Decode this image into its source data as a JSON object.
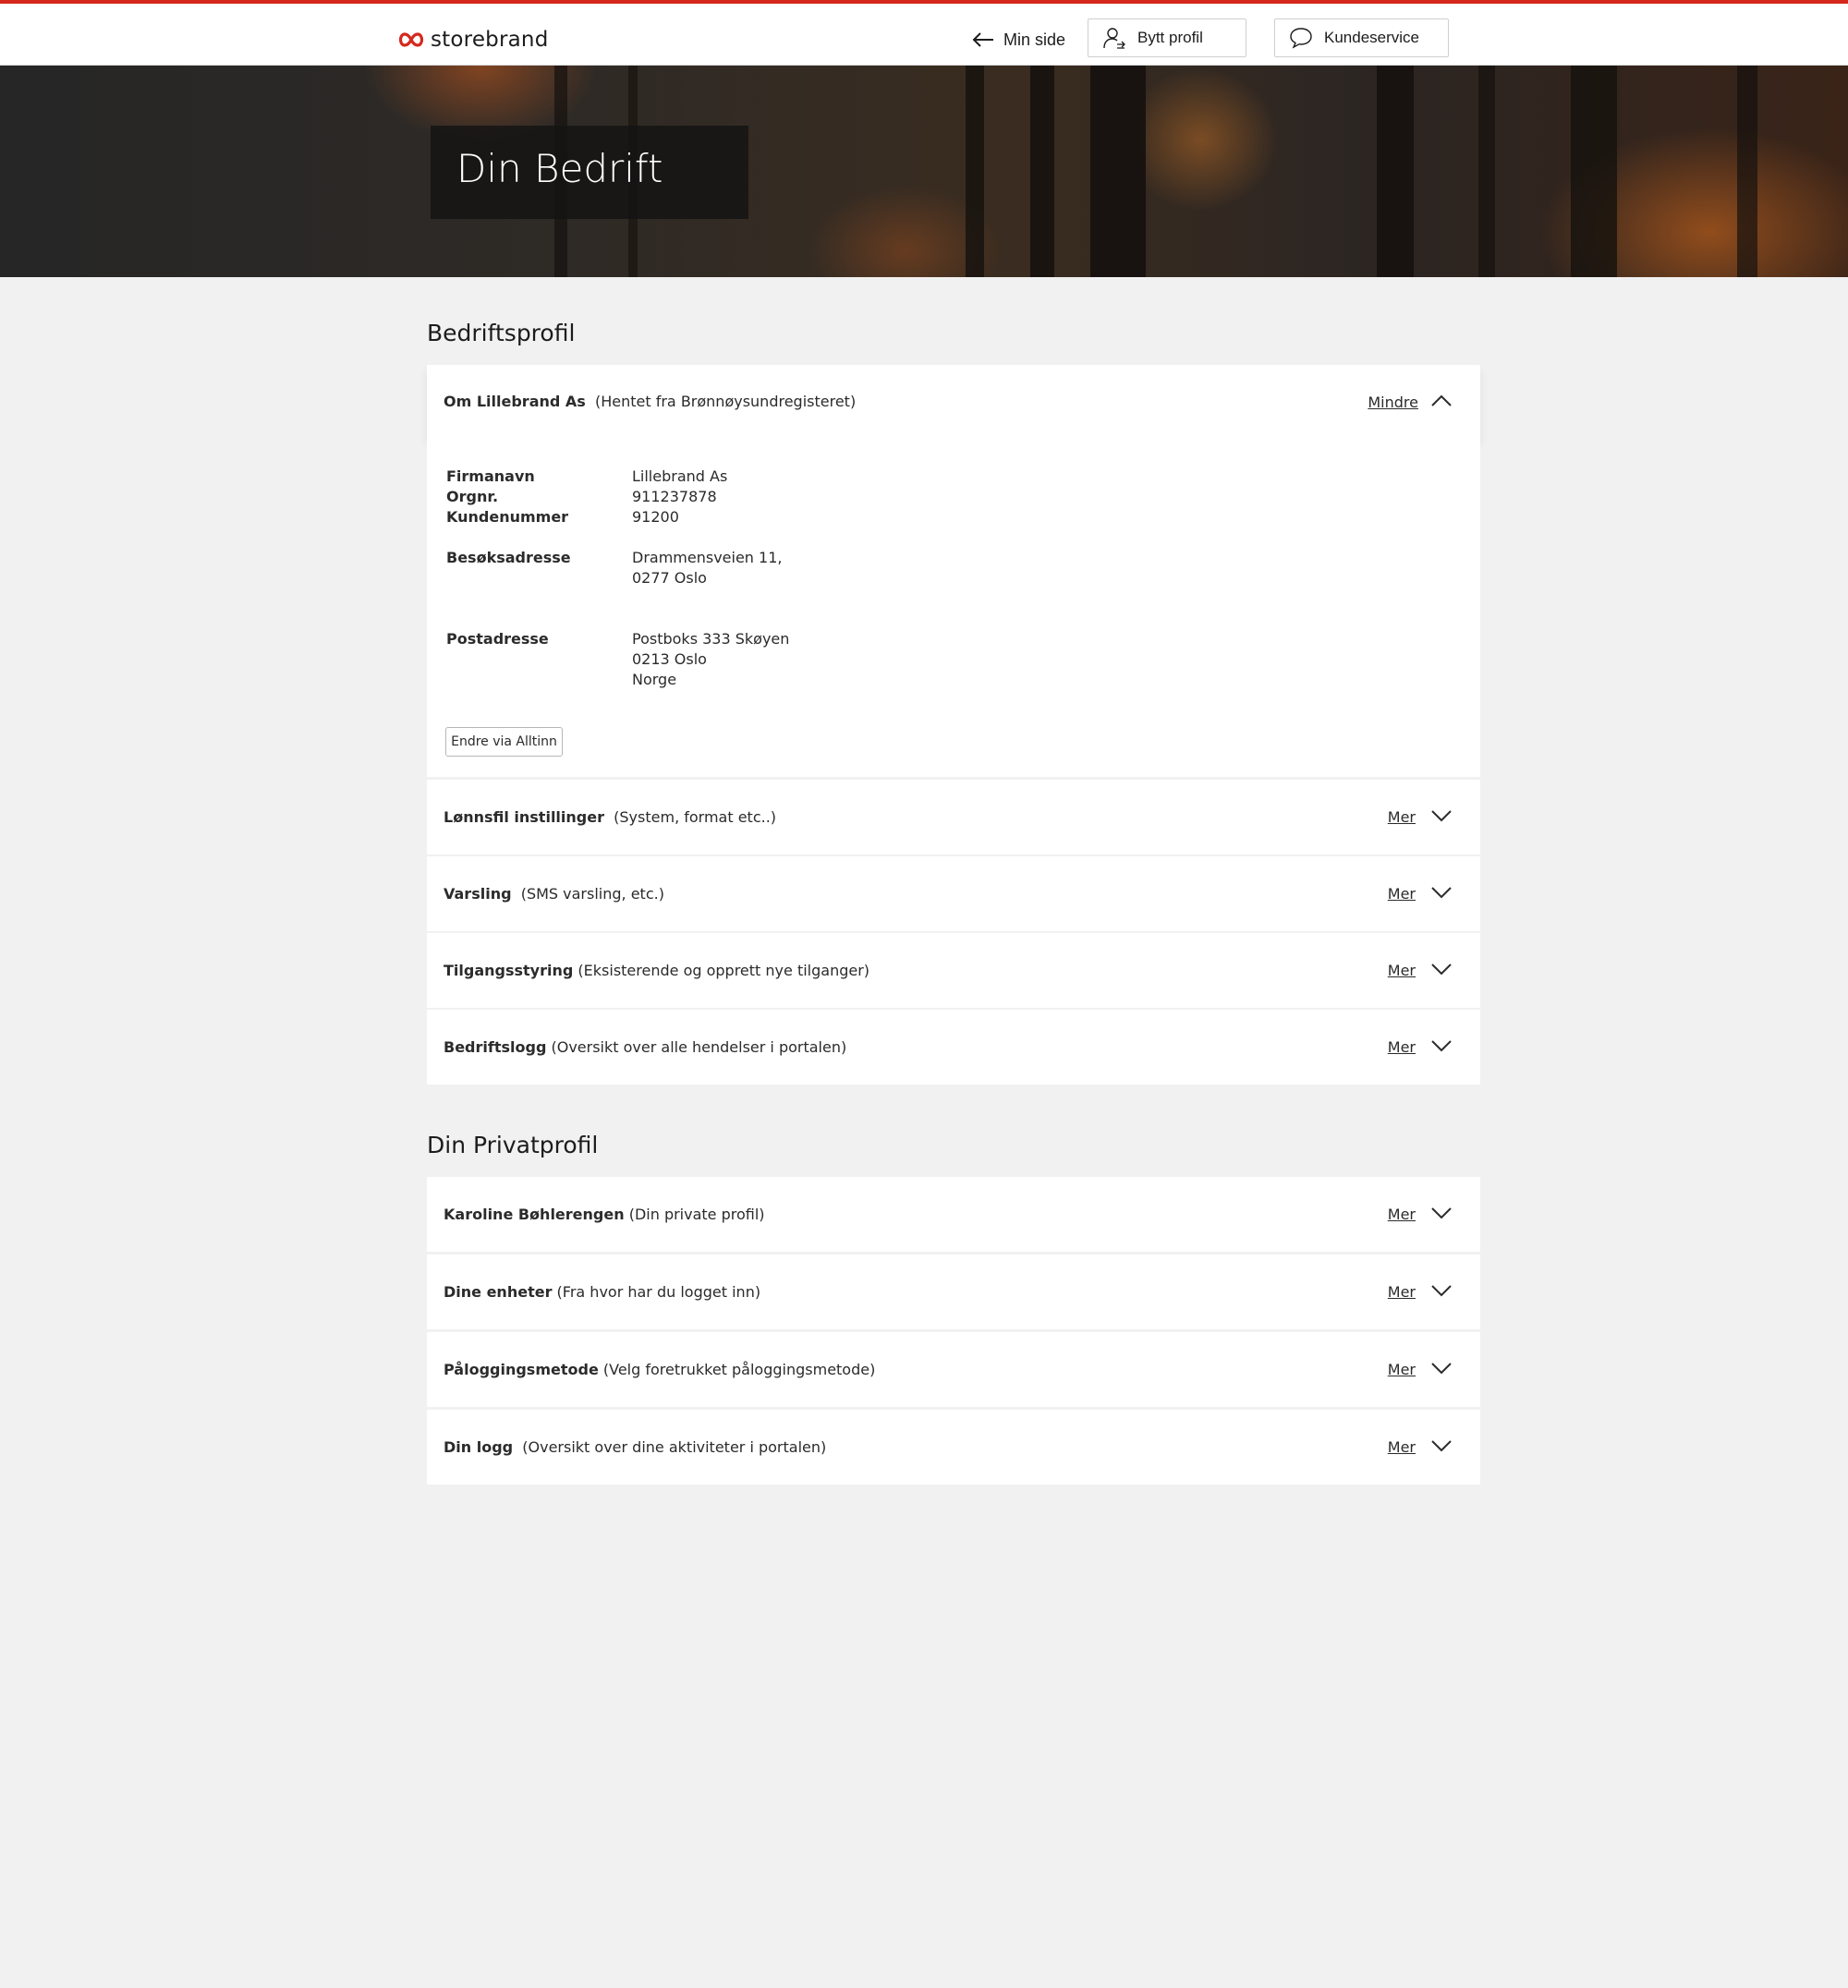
{
  "header": {
    "logo_text": "storebrand",
    "back_label": "Min side",
    "switch_profile_label": "Bytt profil",
    "customer_service_label": "Kundeservice"
  },
  "hero": {
    "title": "Din Bedrift"
  },
  "colors": {
    "accent": "#d5281c",
    "background": "#f1f1f1",
    "card": "#ffffff"
  },
  "company_section": {
    "title": "Bedriftsprofil",
    "open_item": {
      "title": "Om Lillebrand As",
      "subtitle": "(Hentet fra Brønnøysundregisteret)",
      "toggle": "Mindre",
      "fields": {
        "firmanavn_label": "Firmanavn",
        "firmanavn_value": "Lillebrand As",
        "orgnr_label": "Orgnr.",
        "orgnr_value": "911237878",
        "kundenummer_label": "Kundenummer",
        "kundenummer_value": "91200",
        "besok_label": "Besøksadresse",
        "besok_line1": "Drammensveien 11,",
        "besok_line2": "0277 Oslo",
        "post_label": "Postadresse",
        "post_line1": "Postboks 333 Skøyen",
        "post_line2": "0213 Oslo",
        "post_line3": "Norge"
      },
      "edit_button": "Endre via Alltinn"
    },
    "items": [
      {
        "title": "Lønnsfil instillinger",
        "subtitle": "(System, format etc..)",
        "toggle": "Mer"
      },
      {
        "title": "Varsling",
        "subtitle": "(SMS varsling, etc.)",
        "toggle": "Mer"
      },
      {
        "title": "Tilgangsstyring",
        "subtitle": "(Eksisterende og opprett nye tilganger)",
        "toggle": "Mer"
      },
      {
        "title": "Bedriftslogg",
        "subtitle": "(Oversikt over alle hendelser i portalen)",
        "toggle": "Mer"
      }
    ]
  },
  "private_section": {
    "title": "Din Privatprofil",
    "items": [
      {
        "title": "Karoline Bøhlerengen",
        "subtitle": "(Din private profil)",
        "toggle": "Mer"
      },
      {
        "title": "Dine enheter",
        "subtitle": "(Fra hvor har du logget inn)",
        "toggle": "Mer"
      },
      {
        "title": "Påloggingsmetode",
        "subtitle": "(Velg foretrukket påloggingsmetode)",
        "toggle": "Mer"
      },
      {
        "title": "Din logg",
        "subtitle": "(Oversikt over dine aktiviteter i portalen)",
        "toggle": "Mer"
      }
    ]
  }
}
